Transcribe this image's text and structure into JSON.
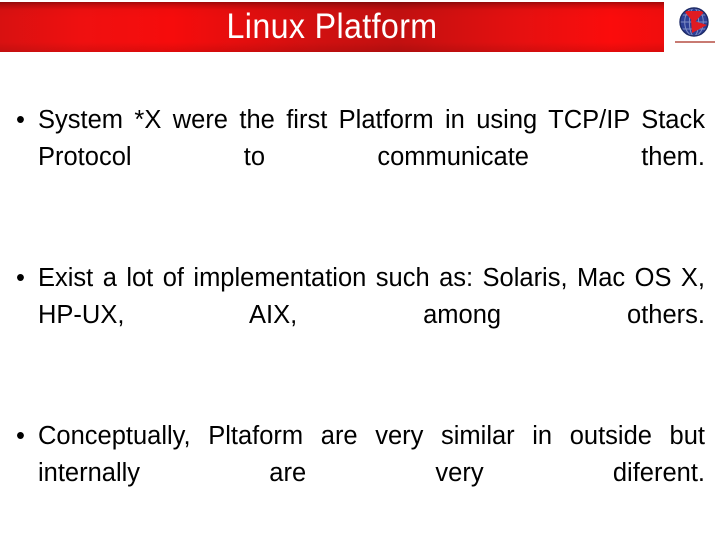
{
  "slide": {
    "title": "Linux Platform",
    "logo": {
      "name": "globe-arrow-logo",
      "globe_color": "#2d3f96",
      "arrow_color": "#e01b22",
      "underline_color": "#c87a72"
    },
    "header": {
      "bar_color_dark": "#c21010",
      "bar_color_bright": "#fb0c0c",
      "title_color": "#ffffff"
    },
    "bullets": [
      {
        "marker": "•",
        "text": "System *X were the first Platform in using TCP/IP Stack Protocol to communicate them."
      },
      {
        "marker": "•",
        "text": "Exist a lot of implementation such as: Solaris, Mac OS X, HP-UX, AIX, among others."
      },
      {
        "marker": "•",
        "text": "Conceptually, Pltaform are very similar in outside but internally are very diferent."
      }
    ]
  }
}
